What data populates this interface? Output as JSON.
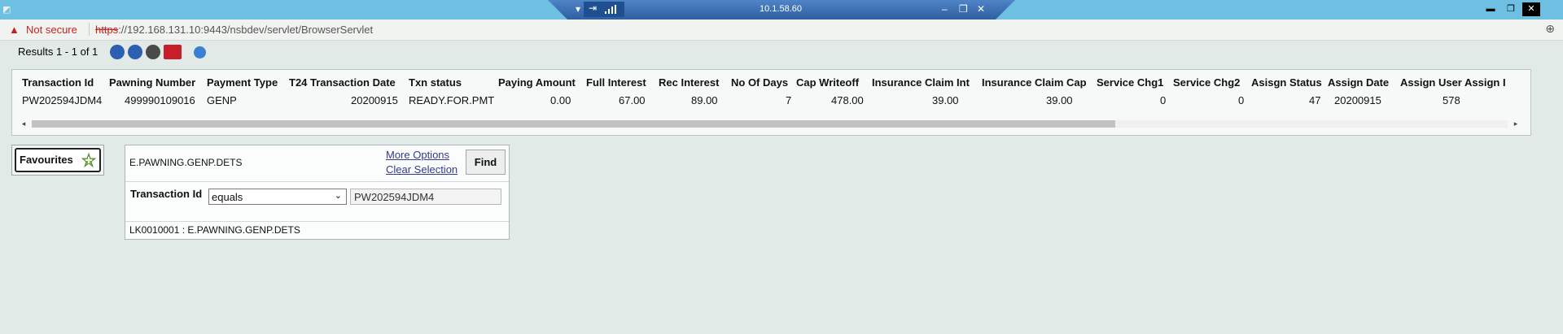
{
  "rdp": {
    "host": "10.1.58.60",
    "pin_icon": "pin-icon",
    "signal_icon": "signal-icon",
    "minimize_icon": "minimize-icon",
    "restore_icon": "restore-icon",
    "close_icon": "close-icon"
  },
  "browser": {
    "security_label": "Not secure",
    "url_scheme": "https",
    "url_rest": "://192.168.131.10:9443/nsbdev/servlet/BrowserServlet",
    "zoom_icon": "zoom-icon"
  },
  "results": {
    "summary": "Results 1 - 1 of 1"
  },
  "grid": {
    "columns": [
      "Transaction Id",
      "Pawning Number",
      "Payment Type",
      "T24 Transaction Date",
      "Txn status",
      "Paying Amount",
      "Full Interest",
      "Rec Interest",
      "No Of Days",
      "Cap Writeoff",
      "Insurance Claim Int",
      "Insurance Claim Cap",
      "Service Chg1",
      "Service Chg2",
      "Asisgn Status",
      "Assign Date",
      "Assign User",
      "Assign I"
    ],
    "rows": [
      [
        "PW202594JDM4",
        "499990109016",
        "GENP",
        "20200915",
        "READY.FOR.PMT",
        "0.00",
        "67.00",
        "89.00",
        "7",
        "478.00",
        "39.00",
        "39.00",
        "0",
        "0",
        "47",
        "20200915",
        "578",
        ""
      ]
    ]
  },
  "favourites": {
    "label": "Favourites",
    "icon": "add-favourite-icon"
  },
  "selection": {
    "enquiry_name": "E.PAWNING.GENP.DETS",
    "more_options": "More Options",
    "clear_selection": "Clear Selection",
    "find": "Find",
    "criteria_label": "Transaction Id",
    "operator": "equals",
    "value": "PW202594JDM4",
    "footer": "LK0010001 : E.PAWNING.GENP.DETS"
  }
}
